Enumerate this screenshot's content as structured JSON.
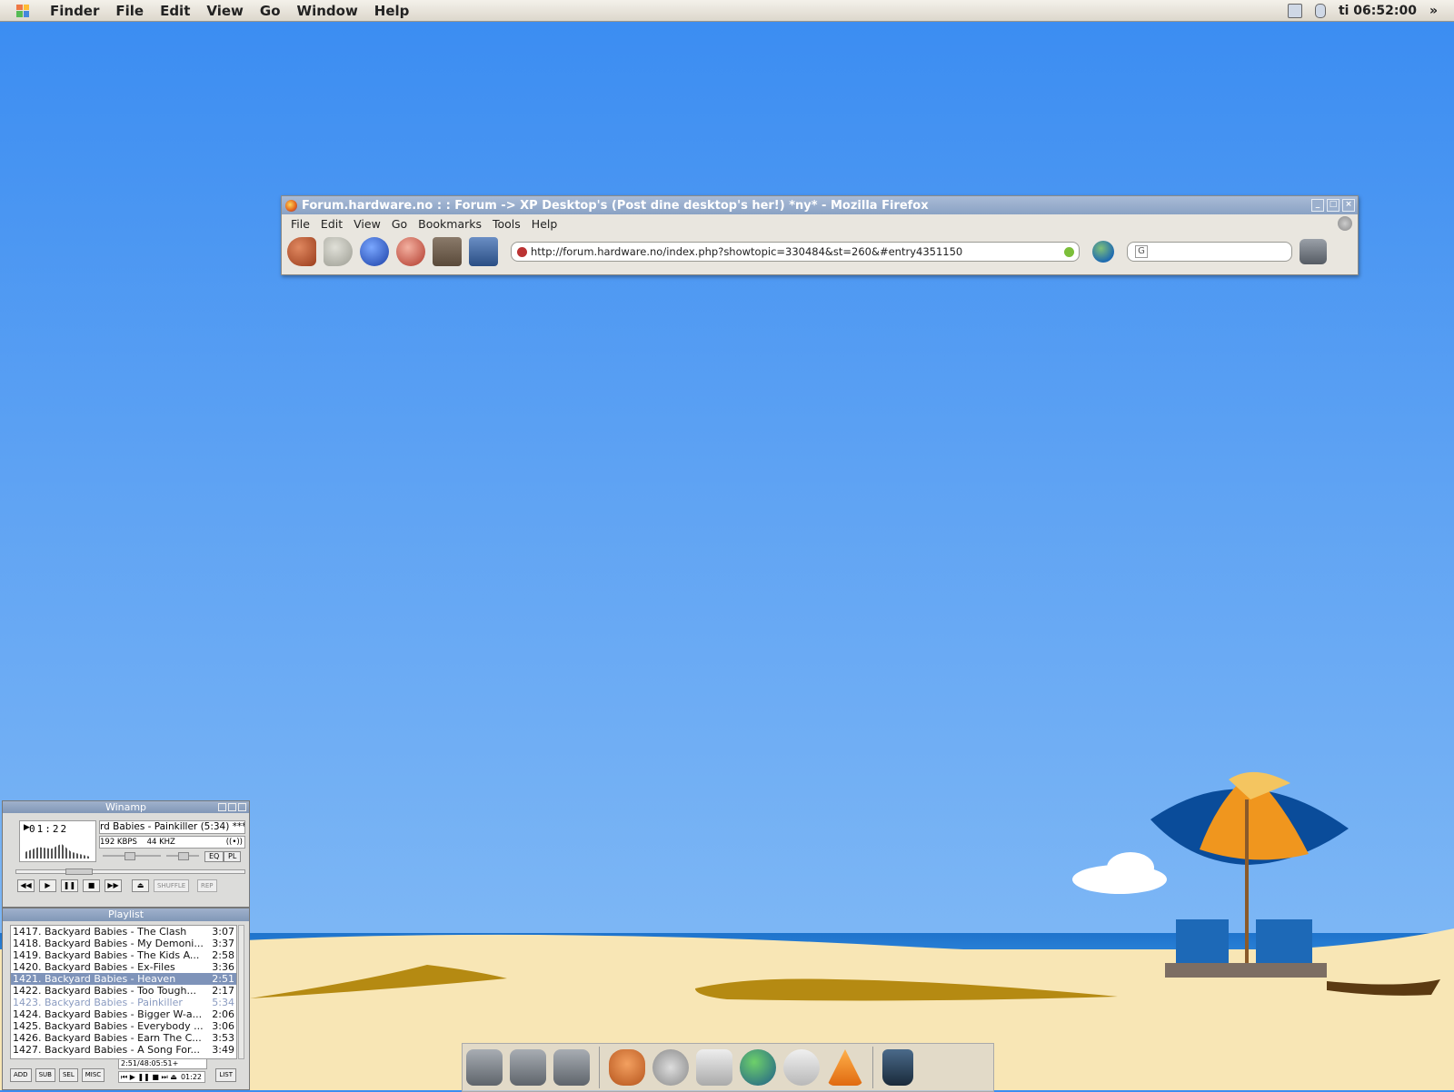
{
  "menubar": {
    "app": "Finder",
    "items": [
      "File",
      "Edit",
      "View",
      "Go",
      "Window",
      "Help"
    ],
    "clock": "ti 06:52:00",
    "overflow": "»"
  },
  "firefox": {
    "title": "Forum.hardware.no : : Forum -> XP Desktop's (Post dine desktop's her!) *ny* - Mozilla Firefox",
    "menus": [
      "File",
      "Edit",
      "View",
      "Go",
      "Bookmarks",
      "Tools",
      "Help"
    ],
    "url": "http://forum.hardware.no/index.php?showtopic=330484&st=260&#entry4351150",
    "search_value": ""
  },
  "winamp": {
    "title": "Winamp",
    "time": "01:22",
    "song": "rd Babies - Painkiller (5:34)  ***",
    "bitrate": "192 KBPS",
    "samplerate": "44 KHZ",
    "stereo": "((•))",
    "eq_label": "EQ",
    "pl_label": "PL",
    "shuffle_label": "SHUFFLE",
    "repeat_label": "REP",
    "volume": 0.5,
    "seek": 0.25
  },
  "playlist": {
    "title": "Playlist",
    "rows": [
      {
        "title": "1417. Backyard Babies - The Clash",
        "dur": "3:07",
        "state": ""
      },
      {
        "title": "1418. Backyard Babies - My Demoni...",
        "dur": "3:37",
        "state": ""
      },
      {
        "title": "1419. Backyard Babies - The Kids A...",
        "dur": "2:58",
        "state": ""
      },
      {
        "title": "1420. Backyard Babies - Ex-Files",
        "dur": "3:36",
        "state": ""
      },
      {
        "title": "1421. Backyard Babies - Heaven",
        "dur": "2:51",
        "state": "sel"
      },
      {
        "title": "1422. Backyard Babies - Too Tough...",
        "dur": "2:17",
        "state": ""
      },
      {
        "title": "1423. Backyard Babies - Painkiller",
        "dur": "5:34",
        "state": "cur"
      },
      {
        "title": "1424. Backyard Babies - Bigger W-a...",
        "dur": "2:06",
        "state": ""
      },
      {
        "title": "1425. Backyard Babies - Everybody ...",
        "dur": "3:06",
        "state": ""
      },
      {
        "title": "1426. Backyard Babies - Earn The C...",
        "dur": "3:53",
        "state": ""
      },
      {
        "title": "1427. Backyard Babies - A Song For...",
        "dur": "3:49",
        "state": ""
      }
    ],
    "buttons": [
      "ADD",
      "SUB",
      "SEL",
      "MISC"
    ],
    "list_label": "LIST",
    "total_time": "2:51/48:05:51+",
    "mini_time": "01:22"
  },
  "dock": {
    "items": [
      "drive-icon",
      "drive-icon",
      "drive-icon",
      "firefox-icon",
      "webcam-icon",
      "mail-icon",
      "globe-icon",
      "people-icon",
      "vlc-icon",
      "trash-icon"
    ]
  }
}
